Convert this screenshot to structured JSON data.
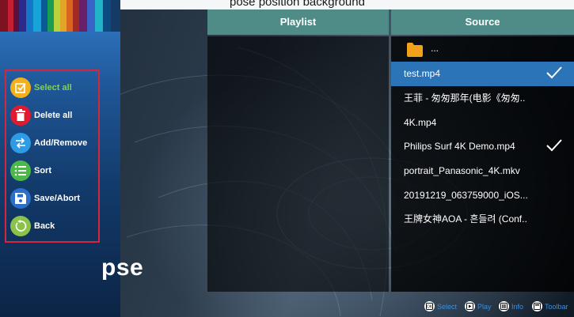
{
  "topbar": {
    "title": "pose position background"
  },
  "panels": {
    "playlist_title": "Playlist",
    "source_title": "Source"
  },
  "source_list": [
    {
      "name": "...",
      "type": "folder",
      "checked": false,
      "selected": false,
      "icon": "folder-icon"
    },
    {
      "name": "test.mp4",
      "type": "file",
      "checked": true,
      "selected": true
    },
    {
      "name": "王菲 - 匆匆那年(电影《匆匆..",
      "type": "file",
      "checked": false,
      "selected": false
    },
    {
      "name": "4K.mp4",
      "type": "file",
      "checked": false,
      "selected": false
    },
    {
      "name": "Philips Surf 4K Demo.mp4",
      "type": "file",
      "checked": true,
      "selected": false
    },
    {
      "name": "portrait_Panasonic_4K.mkv",
      "type": "file",
      "checked": false,
      "selected": false
    },
    {
      "name": "20191219_063759000_iOS...",
      "type": "file",
      "checked": false,
      "selected": false
    },
    {
      "name": "王牌女神AOA - 흔들려 (Conf..",
      "type": "file",
      "checked": false,
      "selected": false
    }
  ],
  "menu": {
    "items": [
      {
        "label": "Select all",
        "icon": "select-all-icon",
        "color": "#f2b01e",
        "selected": true
      },
      {
        "label": "Delete all",
        "icon": "trash-icon",
        "color": "#e01b2f",
        "selected": false
      },
      {
        "label": "Add/Remove",
        "icon": "swap-arrows-icon",
        "color": "#2e9be6",
        "selected": false
      },
      {
        "label": "Sort",
        "icon": "list-icon",
        "color": "#4cb84a",
        "selected": false
      },
      {
        "label": "Save/Abort",
        "icon": "save-icon",
        "color": "#2a6fc9",
        "selected": false
      },
      {
        "label": "Back",
        "icon": "back-icon",
        "color": "#8bc34a",
        "selected": false
      }
    ]
  },
  "background_text": "pse",
  "hints": [
    {
      "label": "Select",
      "icon": "ok-button-icon"
    },
    {
      "label": "Play",
      "icon": "play-button-icon"
    },
    {
      "label": "Info",
      "icon": "info-button-icon"
    },
    {
      "label": "Toolbar",
      "icon": "toolbar-button-icon"
    }
  ],
  "colors": {
    "panel_header": "#4f8c87",
    "selected_row": "#2c74b8",
    "menu_border": "#d6263e",
    "selected_label": "#7fd05a",
    "hint_label": "#3a8ee0"
  }
}
